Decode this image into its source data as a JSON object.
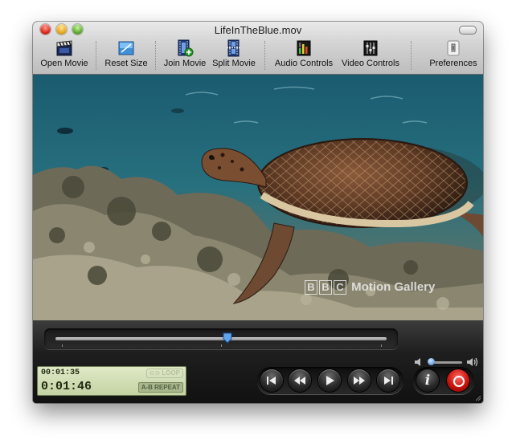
{
  "window": {
    "title": "LifeInTheBlue.mov"
  },
  "toolbar": {
    "open_movie": "Open Movie",
    "reset_size": "Reset Size",
    "join_movie": "Join Movie",
    "split_movie": "Split Movie",
    "audio_controls": "Audio Controls",
    "video_controls": "Video Controls",
    "preferences": "Preferences"
  },
  "video": {
    "watermark_boxes": [
      "B",
      "B",
      "C"
    ],
    "watermark_text": "Motion Gallery"
  },
  "playback": {
    "position_fraction": 0.52,
    "volume_fraction": 0.08,
    "current_time": "00:01:35",
    "duration": "0:01:46",
    "loop_label": "LOOP",
    "ab_repeat_label": "A-B REPEAT"
  },
  "colors": {
    "lcd_background": "#d6e2b8",
    "record_button": "#d8231b",
    "accent_thumb": "#3a78c9"
  },
  "icons": [
    "clapboard-icon",
    "reset-size-icon",
    "join-movie-icon",
    "split-movie-icon",
    "audio-controls-icon",
    "video-controls-icon",
    "preferences-icon",
    "skip-back-icon",
    "rewind-icon",
    "play-icon",
    "fast-forward-icon",
    "skip-forward-icon",
    "info-icon",
    "record-icon",
    "volume-low-icon",
    "volume-high-icon"
  ]
}
